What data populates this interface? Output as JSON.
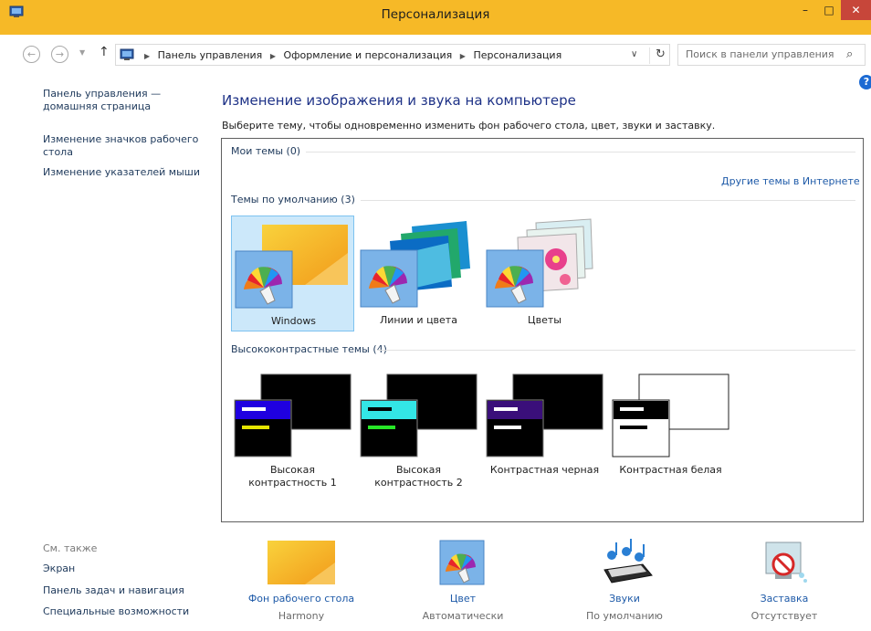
{
  "window": {
    "title": "Персонализация",
    "minimize": "–",
    "maximize": "□",
    "close": "✕"
  },
  "nav": {
    "back": "←",
    "forward": "→",
    "up": "↑",
    "breadcrumbs": [
      "Панель управления",
      "Оформление и персонализация",
      "Персонализация"
    ],
    "search_placeholder": "Поиск в панели управления"
  },
  "sidebar": {
    "home": "Панель управления — домашняя страница",
    "desktop_icons": "Изменение значков рабочего стола",
    "mouse_pointers": "Изменение указателей мыши"
  },
  "main": {
    "heading": "Изменение изображения и звука на компьютере",
    "subtitle": "Выберите тему, чтобы одновременно изменить фон рабочего стола, цвет, звуки и заставку."
  },
  "groups": {
    "my_themes": "Мои темы (0)",
    "online_link": "Другие темы в Интернете",
    "default_themes": "Темы по умолчанию (3)",
    "high_contrast": "Высококонтрастные темы (4)"
  },
  "default_themes": [
    {
      "name": "Windows",
      "selected": true
    },
    {
      "name": "Линии и цвета",
      "selected": false
    },
    {
      "name": "Цветы",
      "selected": false
    }
  ],
  "contrast_themes": [
    {
      "name": "Высокая контрастность 1"
    },
    {
      "name": "Высокая контрастность 2"
    },
    {
      "name": "Контрастная черная"
    },
    {
      "name": "Контрастная белая"
    }
  ],
  "see_also": {
    "title": "См. также",
    "links": [
      "Экран",
      "Панель задач и навигация",
      "Специальные возможности"
    ]
  },
  "bottom": {
    "background": {
      "label": "Фон рабочего стола",
      "value": "Harmony"
    },
    "color": {
      "label": "Цвет",
      "value": "Автоматически"
    },
    "sounds": {
      "label": "Звуки",
      "value": "По умолчанию"
    },
    "screensaver": {
      "label": "Заставка",
      "value": "Отсутствует"
    }
  },
  "colors": {
    "titlebar": "#f6b927",
    "selection": "#cce8fa",
    "link": "#1e5aa8",
    "heading": "#1e3287"
  }
}
